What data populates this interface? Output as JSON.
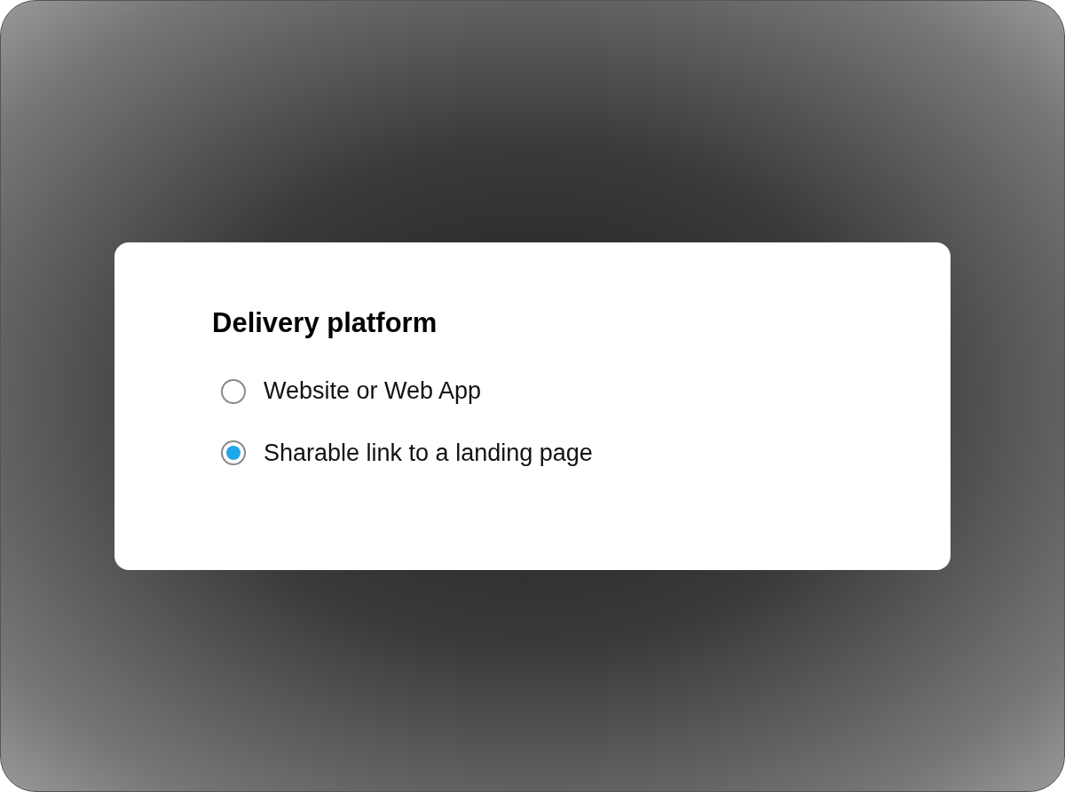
{
  "dialog": {
    "title": "Delivery platform",
    "options": [
      {
        "label": "Website or Web App",
        "selected": false
      },
      {
        "label": "Sharable link to a landing page",
        "selected": true
      }
    ]
  }
}
